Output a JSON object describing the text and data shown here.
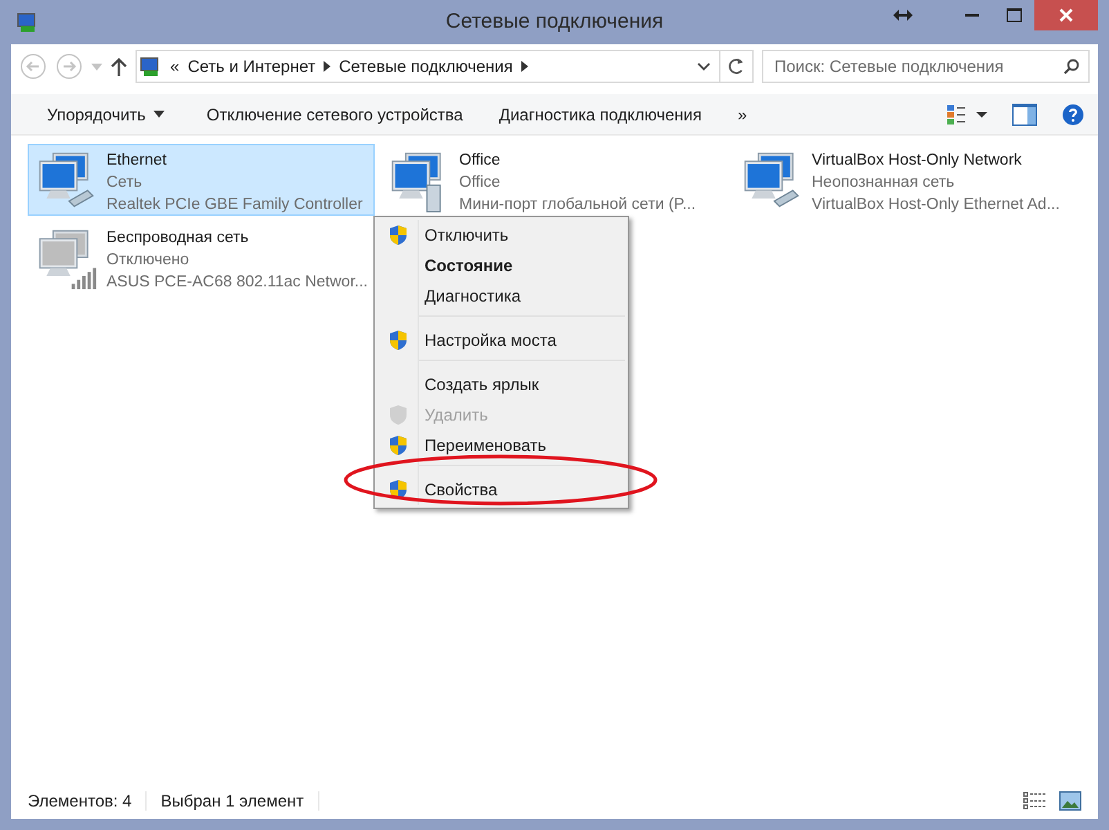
{
  "window": {
    "title": "Сетевые подключения"
  },
  "address_bar": {
    "breadcrumbs": [
      "Сеть и Интернет",
      "Сетевые подключения"
    ],
    "overflow": "«"
  },
  "search": {
    "placeholder": "Поиск: Сетевые подключения"
  },
  "toolbar": {
    "buttons": [
      {
        "label": "Упорядочить",
        "dropdown": true
      },
      {
        "label": "Отключение сетевого устройства",
        "dropdown": false
      },
      {
        "label": "Диагностика подключения",
        "dropdown": false
      }
    ],
    "more": "»"
  },
  "connections": [
    {
      "kind": "ethernet",
      "name": "Ethernet",
      "status": "Сеть",
      "device": "Realtek PCIe GBE Family Controller",
      "selected": true
    },
    {
      "kind": "wan",
      "name": "Office",
      "status": "Office",
      "device": "Мини-порт глобальной сети (P...",
      "selected": false
    },
    {
      "kind": "ethernet",
      "name": "VirtualBox Host-Only Network",
      "status": "Неопознанная сеть",
      "device": "VirtualBox Host-Only Ethernet Ad...",
      "selected": false
    },
    {
      "kind": "wireless",
      "name": "Беспроводная сеть",
      "status": "Отключено",
      "device": "ASUS PCE-AC68 802.11ac Networ...",
      "selected": false
    }
  ],
  "context_menu": [
    {
      "kind": "item",
      "label": "Отключить",
      "shield": true,
      "bold": false,
      "disabled": false
    },
    {
      "kind": "item",
      "label": "Состояние",
      "shield": false,
      "bold": true,
      "disabled": false
    },
    {
      "kind": "item",
      "label": "Диагностика",
      "shield": false,
      "bold": false,
      "disabled": false
    },
    {
      "kind": "separator"
    },
    {
      "kind": "item",
      "label": "Настройка моста",
      "shield": true,
      "bold": false,
      "disabled": false
    },
    {
      "kind": "separator"
    },
    {
      "kind": "item",
      "label": "Создать ярлык",
      "shield": false,
      "bold": false,
      "disabled": false
    },
    {
      "kind": "item",
      "label": "Удалить",
      "shield": true,
      "bold": false,
      "disabled": true
    },
    {
      "kind": "item",
      "label": "Переименовать",
      "shield": true,
      "bold": false,
      "disabled": false
    },
    {
      "kind": "separator"
    },
    {
      "kind": "item",
      "label": "Свойства",
      "shield": true,
      "bold": false,
      "disabled": false,
      "circled": true
    }
  ],
  "status_bar": {
    "count": "Элементов: 4",
    "selection": "Выбран 1 элемент"
  }
}
